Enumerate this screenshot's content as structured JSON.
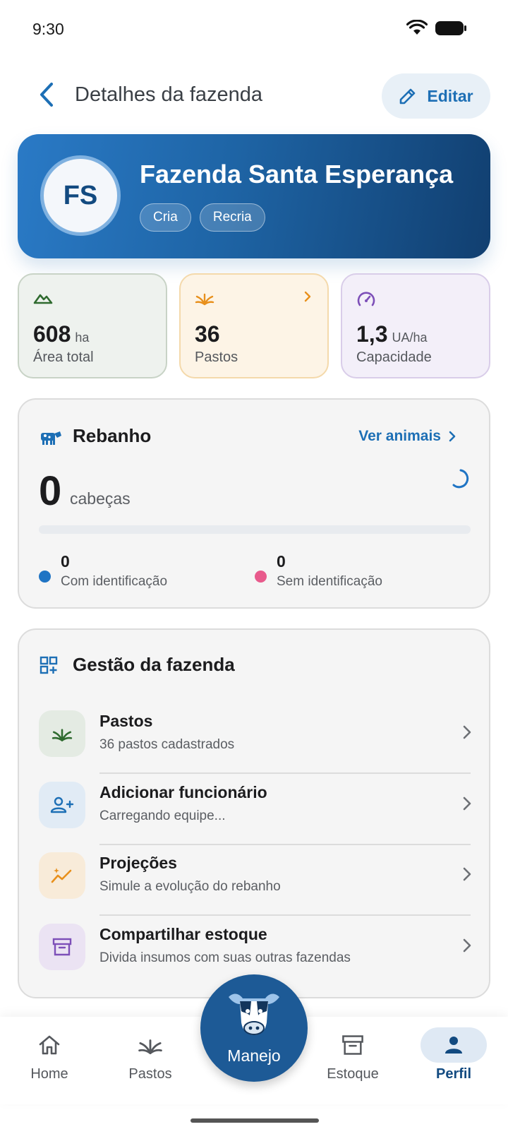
{
  "status_bar": {
    "time": "9:30"
  },
  "header": {
    "title": "Detalhes da fazenda",
    "edit_label": "Editar"
  },
  "farm": {
    "initials": "FS",
    "name": "Fazenda Santa Esperança",
    "tags": [
      "Cria",
      "Recria"
    ]
  },
  "stats": {
    "area": {
      "value": "608",
      "unit": "ha",
      "label": "Área total"
    },
    "pastos": {
      "value": "36",
      "label": "Pastos"
    },
    "capacidade": {
      "value": "1,3",
      "unit": "UA/ha",
      "label": "Capacidade"
    }
  },
  "herd": {
    "title": "Rebanho",
    "see_animals_label": "Ver animais",
    "count": "0",
    "count_unit": "cabeças",
    "identified_fraction": 0,
    "with_id": {
      "value": "0",
      "label": "Com identificação"
    },
    "without_id": {
      "value": "0",
      "label": "Sem identificação"
    }
  },
  "management": {
    "title": "Gestão da fazenda",
    "items": [
      {
        "title": "Pastos",
        "subtitle": "36 pastos cadastrados",
        "icon": "grass-icon"
      },
      {
        "title": "Adicionar funcionário",
        "subtitle": "Carregando equipe...",
        "icon": "add-person-icon"
      },
      {
        "title": "Projeções",
        "subtitle": "Simule a evolução do rebanho",
        "icon": "trend-sparkle-icon"
      },
      {
        "title": "Compartilhar estoque",
        "subtitle": "Divida insumos com suas outras fazendas",
        "icon": "archive-box-icon"
      }
    ]
  },
  "bottom_nav": {
    "items": [
      {
        "label": "Home",
        "icon": "home-icon"
      },
      {
        "label": "Pastos",
        "icon": "grass-icon"
      },
      {
        "label": "Manejo",
        "icon": "cow-icon"
      },
      {
        "label": "Estoque",
        "icon": "archive-box-icon"
      },
      {
        "label": "Perfil",
        "icon": "person-icon",
        "active": true
      }
    ]
  },
  "colors": {
    "primary": "#1d6fb5",
    "primary_dark": "#124a80",
    "green": "#3a6b35",
    "orange": "#e8901c",
    "purple": "#7d4fb8",
    "pink": "#e85a8c"
  }
}
